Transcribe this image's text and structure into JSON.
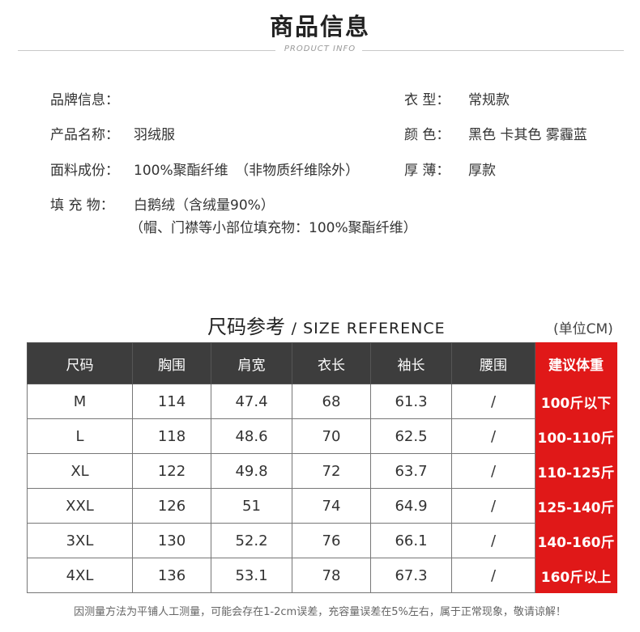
{
  "header": {
    "title": "商品信息",
    "subtitle": "PRODUCT INFO"
  },
  "info": {
    "brand_label": "品牌信息：",
    "brand_value": "",
    "name_label": "产品名称：",
    "name_value": "羽绒服",
    "fabric_label": "面料成份：",
    "fabric_value": "100%聚酯纤维　（非物质纤维除外）",
    "fill_label": "填 充 物：",
    "fill_value_1": "白鹅绒（含绒量90%）",
    "fill_value_2": "（帽、门襟等小部位填充物：100%聚酯纤维）",
    "type_label": "衣  型：",
    "type_value": "常规款",
    "color_label": "颜  色：",
    "color_value": "黑色 卡其色 雾霾蓝",
    "thickness_label": "厚  薄：",
    "thickness_value": "厚款"
  },
  "size_ref": {
    "title_cn": "尺码参考",
    "title_en": "/ SIZE REFERENCE",
    "unit": "(单位CM)"
  },
  "size_table": {
    "headers": [
      "尺码",
      "胸围",
      "肩宽",
      "衣长",
      "袖长",
      "腰围",
      "建议体重"
    ],
    "rows": [
      [
        "M",
        "114",
        "47.4",
        "68",
        "61.3",
        "/",
        "100斤以下"
      ],
      [
        "L",
        "118",
        "48.6",
        "70",
        "62.5",
        "/",
        "100-110斤"
      ],
      [
        "XL",
        "122",
        "49.8",
        "72",
        "63.7",
        "/",
        "110-125斤"
      ],
      [
        "XXL",
        "126",
        "51",
        "74",
        "64.9",
        "/",
        "125-140斤"
      ],
      [
        "3XL",
        "130",
        "52.2",
        "76",
        "66.1",
        "/",
        "140-160斤"
      ],
      [
        "4XL",
        "136",
        "53.1",
        "78",
        "67.3",
        "/",
        "160斤以上"
      ]
    ]
  },
  "note": "因测量方法为平铺人工测量，可能会存在1-2cm误差，充容量误差在5%左右，属于正常现象，敬请谅解！",
  "colors": {
    "accent_red": "#e01818",
    "header_dark": "#3d3d3d"
  }
}
